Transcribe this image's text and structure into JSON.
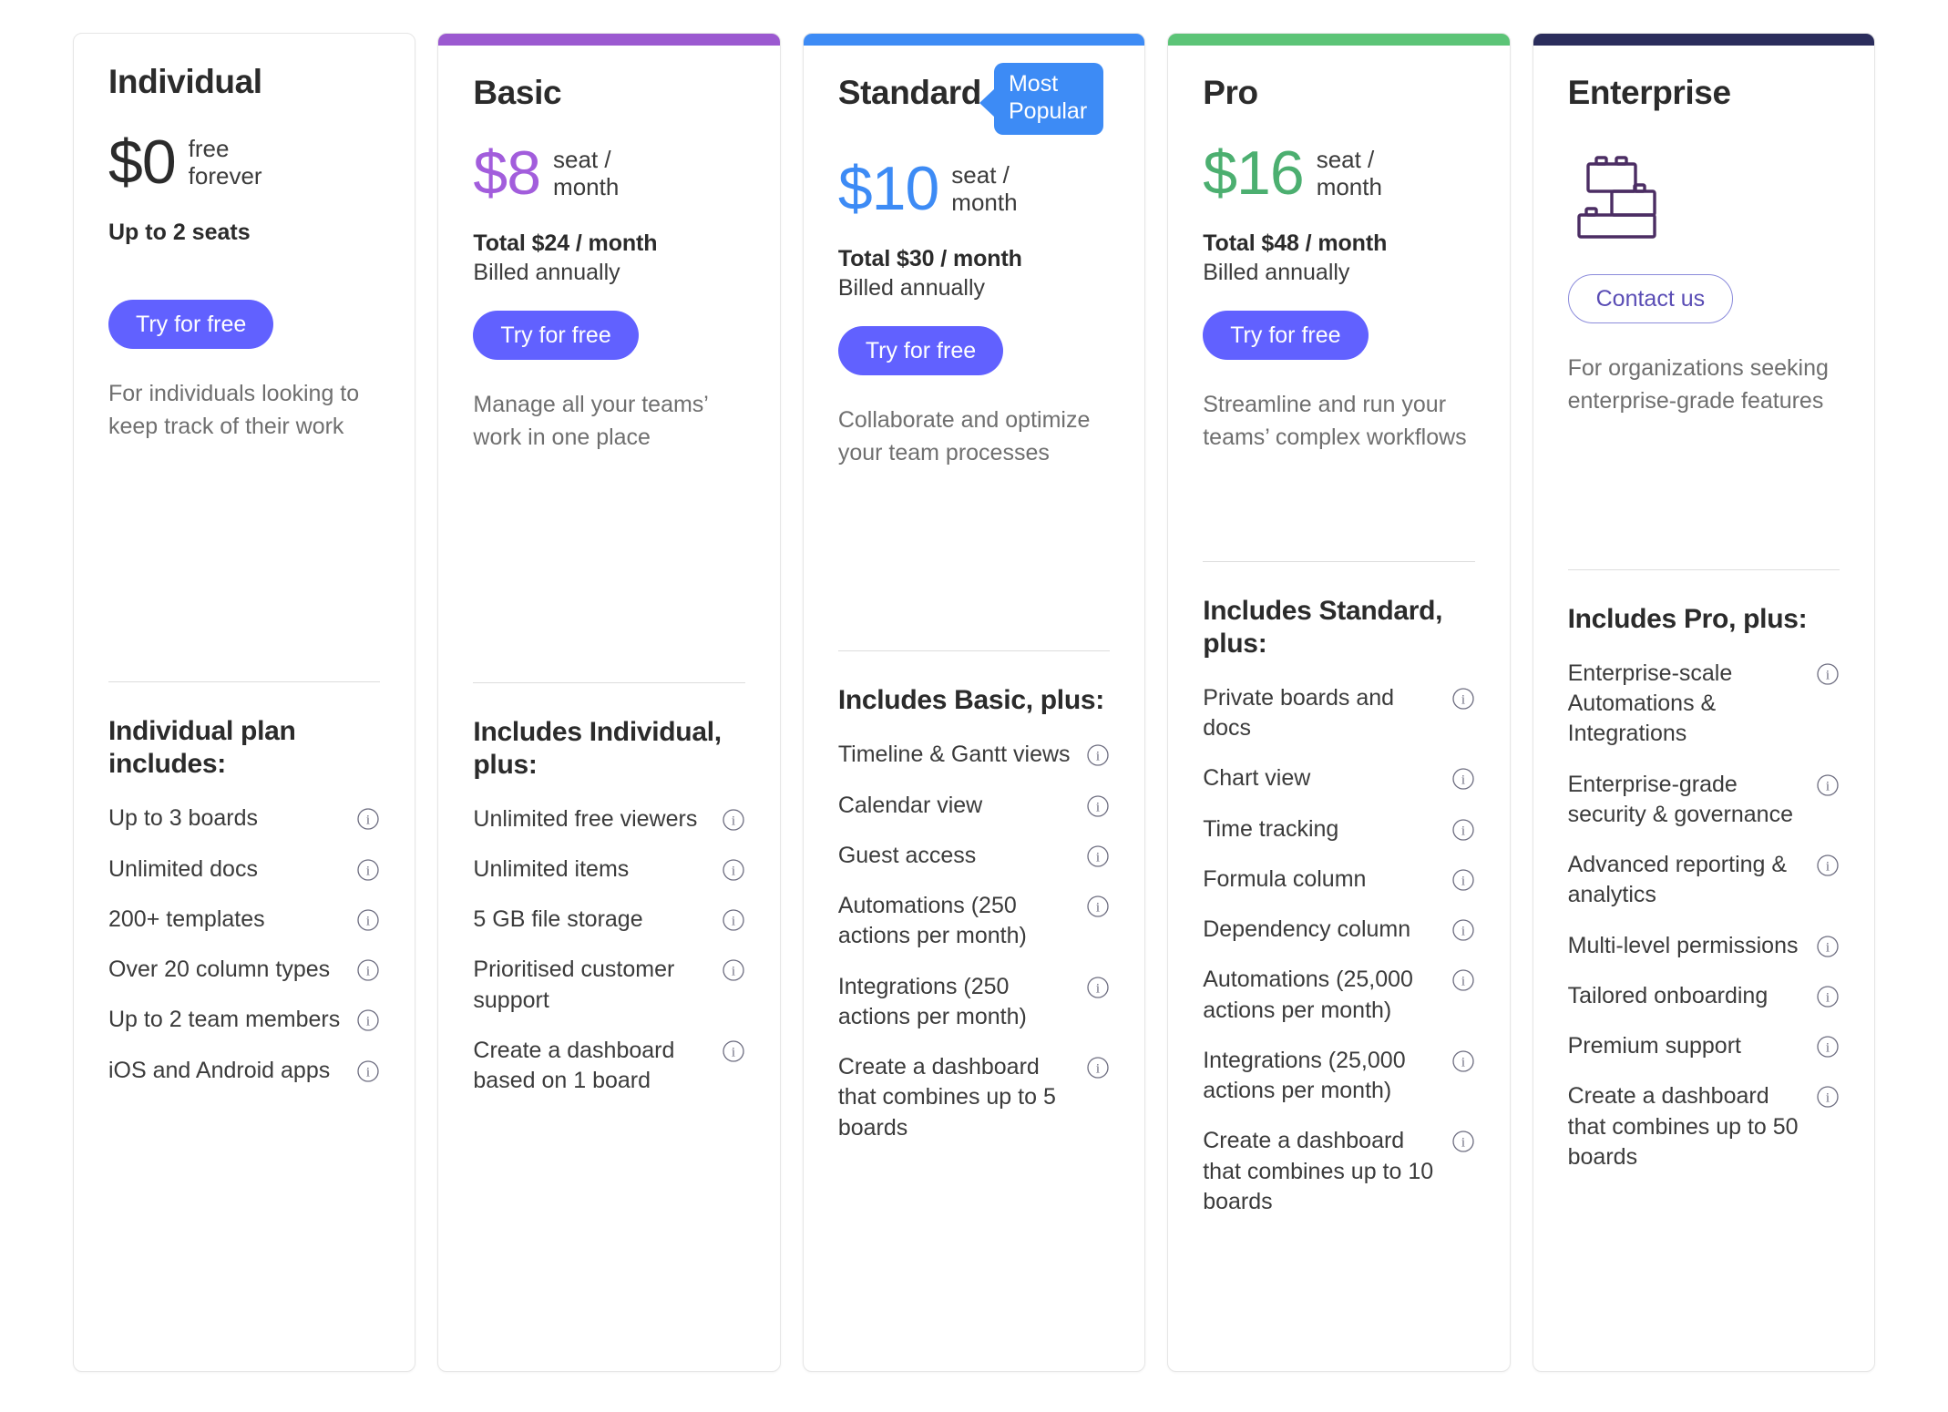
{
  "colors": {
    "cta": "#6161ff",
    "individual_price": "#2b2b2b",
    "basic_bar": "#9b59d0",
    "basic_price": "#a25ddc",
    "standard_bar": "#3d8bf5",
    "standard_price": "#3d8bf5",
    "pro_bar": "#5cc477",
    "pro_price": "#4caf70",
    "enterprise_bar": "#2b2d5c",
    "enterprise_icon": "#4b2d63"
  },
  "plans": [
    {
      "id": "individual",
      "name": "Individual",
      "badge": null,
      "price": "$0",
      "price_unit": "free\nforever",
      "total": null,
      "billed": null,
      "seats": "Up to 2 seats",
      "cta": "Try for free",
      "description": "For individuals looking to keep track of their work",
      "includes_title": "Individual plan includes:",
      "features": [
        "Up to 3 boards",
        "Unlimited docs",
        "200+ templates",
        "Over 20 column types",
        "Up to 2 team members",
        "iOS and Android apps"
      ]
    },
    {
      "id": "basic",
      "name": "Basic",
      "badge": null,
      "price": "$8",
      "price_unit": "seat /\nmonth",
      "total": "Total $24 / month",
      "billed": "Billed annually",
      "seats": null,
      "cta": "Try for free",
      "description": "Manage all your teams’ work in one place",
      "includes_title": "Includes Individual, plus:",
      "features": [
        "Unlimited free viewers",
        "Unlimited items",
        "5 GB file storage",
        "Prioritised customer support",
        "Create a dashboard based on 1 board"
      ]
    },
    {
      "id": "standard",
      "name": "Standard",
      "badge": "Most Popular",
      "price": "$10",
      "price_unit": "seat /\nmonth",
      "total": "Total $30 / month",
      "billed": "Billed annually",
      "seats": null,
      "cta": "Try for free",
      "description": "Collaborate and optimize your team processes",
      "includes_title": "Includes Basic, plus:",
      "features": [
        "Timeline & Gantt views",
        "Calendar view",
        "Guest access",
        "Automations (250 actions per month)",
        "Integrations (250 actions per month)",
        "Create a dashboard that combines up to 5 boards"
      ]
    },
    {
      "id": "pro",
      "name": "Pro",
      "badge": null,
      "price": "$16",
      "price_unit": "seat /\nmonth",
      "total": "Total $48 / month",
      "billed": "Billed annually",
      "seats": null,
      "cta": "Try for free",
      "description": "Streamline and run your teams’ complex workflows",
      "includes_title": "Includes Standard, plus:",
      "features": [
        "Private boards and docs",
        "Chart view",
        "Time tracking",
        "Formula column",
        "Dependency column",
        "Automations (25,000 actions per month)",
        "Integrations (25,000 actions per month)",
        "Create a dashboard that combines up to 10 boards"
      ]
    },
    {
      "id": "enterprise",
      "name": "Enterprise",
      "badge": null,
      "price": null,
      "price_unit": null,
      "total": null,
      "billed": null,
      "seats": null,
      "cta": "Contact us",
      "icon": "blocks-icon",
      "description": "For organizations seeking enterprise-grade features",
      "includes_title": "Includes Pro, plus:",
      "features": [
        "Enterprise-scale Automations & Integrations",
        "Enterprise-grade security & governance",
        "Advanced reporting & analytics",
        "Multi-level permissions",
        "Tailored onboarding",
        "Premium support",
        "Create a dashboard that combines up to 50 boards"
      ]
    }
  ],
  "icons": {
    "info": "info-icon",
    "blocks": "blocks-icon"
  }
}
